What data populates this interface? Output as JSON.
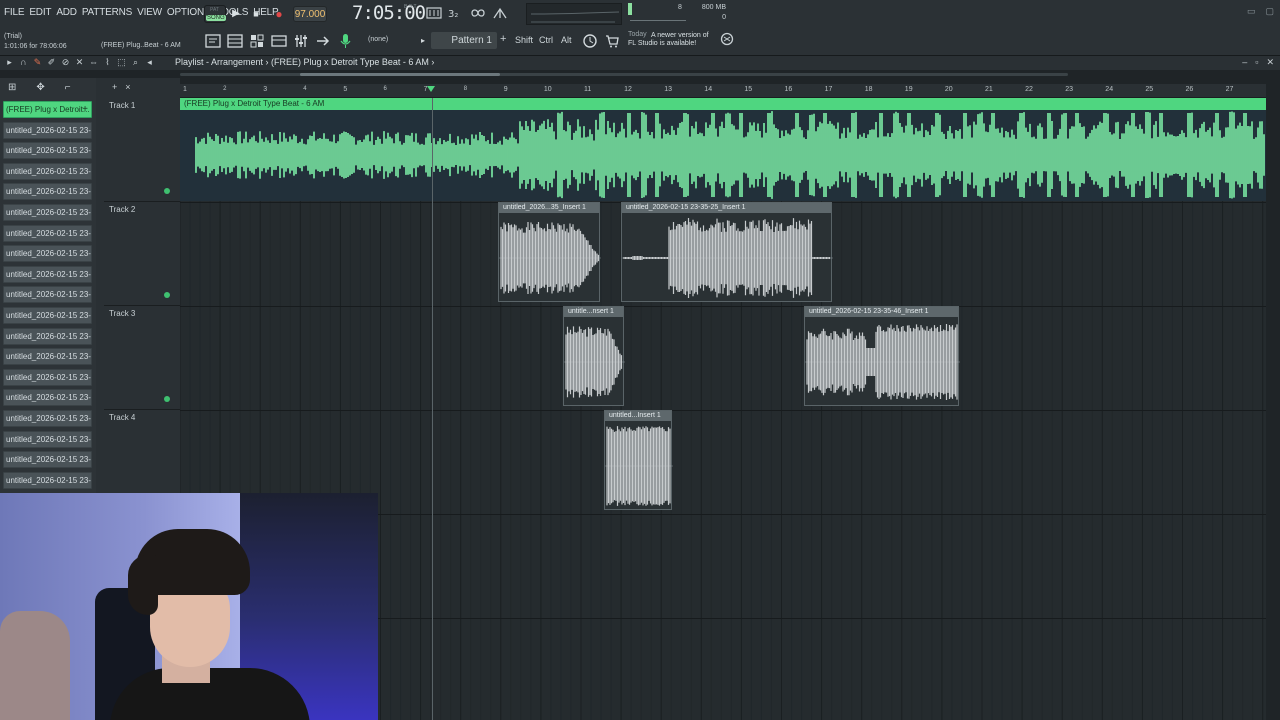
{
  "menu": [
    "FILE",
    "EDIT",
    "ADD",
    "PATTERNS",
    "VIEW",
    "OPTIONS",
    "TOOLS",
    "HELP"
  ],
  "transport": {
    "mode_pat": "PAT",
    "mode_song": "SONG",
    "tempo": "97.000",
    "time": "7:05:00",
    "time_sub": "B:S:T",
    "cpu_value": "8",
    "mem_mb": "800 MB",
    "mem_val": "0"
  },
  "info": {
    "trial": "(Trial)",
    "position": "1:01:06 for 78:06:06",
    "hint": "(FREE) Plug..Beat - 6 AM",
    "snap": "(none)",
    "pattern": "Pattern 1",
    "pattern_add": "+",
    "shift": "Shift",
    "ctrl": "Ctrl",
    "alt": "Alt",
    "news_day": "Today",
    "news_line1": "A newer version of",
    "news_line2": "FL Studio is available!"
  },
  "playlist": {
    "title": "Playlist - Arrangement › (FREE) Plug x Detroit Type Beat - 6 AM ›",
    "ruler": [
      "1",
      "2",
      "3",
      "4",
      "5",
      "6",
      "7",
      "8",
      "9",
      "10",
      "11",
      "12",
      "13",
      "14",
      "15",
      "16",
      "17",
      "18",
      "19",
      "20",
      "21",
      "22",
      "23",
      "24",
      "25",
      "26",
      "27"
    ]
  },
  "picker": {
    "items": [
      "(FREE) Plug x Detroit...",
      "untitled_2026-02-15 23-...",
      "untitled_2026-02-15 23-...",
      "untitled_2026-02-15 23-...",
      "untitled_2026-02-15 23-...",
      "untitled_2026-02-15 23-...",
      "untitled_2026-02-15 23-...",
      "untitled_2026-02-15 23-...",
      "untitled_2026-02-15 23-...",
      "untitled_2026-02-15 23-...",
      "untitled_2026-02-15 23-...",
      "untitled_2026-02-15 23-...",
      "untitled_2026-02-15 23-...",
      "untitled_2026-02-15 23-...",
      "untitled_2026-02-15 23-...",
      "untitled_2026-02-15 23-...",
      "untitled_2026-02-15 23-...",
      "untitled_2026-02-15 23-...",
      "untitled_2026-02-15 23-..."
    ]
  },
  "tracks": [
    "Track 1",
    "Track 2",
    "Track 3",
    "Track 4"
  ],
  "clips": {
    "main": "(FREE) Plug x Detroit Type Beat - 6 AM",
    "c1": "untitled_2026...35_Insert 1",
    "c2": "untitled_2026-02-15 23-35-25_Insert 1",
    "c3": "untitle...nsert 1",
    "c4": "untitled_2026-02-15 23-35-46_Insert 1",
    "c5": "untitled...Insert 1"
  },
  "colors": {
    "accent": "#4fd680",
    "wave_main": "#7ef0a8",
    "wave_clip": "#c8ccce",
    "record": "#e04848"
  },
  "icons": {
    "play": "▶",
    "stop": "■",
    "record": "●"
  }
}
